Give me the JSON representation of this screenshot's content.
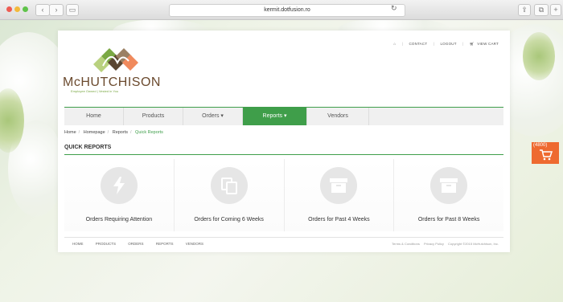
{
  "browser": {
    "url": "kermit.dotfusion.ro",
    "back_icon": "chevron-left-icon",
    "forward_icon": "chevron-right-icon"
  },
  "header": {
    "links": [
      {
        "label": "CONTACT"
      },
      {
        "label": "LOGOUT"
      },
      {
        "label": "VIEW CART"
      }
    ]
  },
  "logo": {
    "name": "McHUTCHISON",
    "tagline": "Employee Owned | Vested in You",
    "colors": {
      "green": "#7aa844",
      "brown": "#6b4a2e",
      "orange": "#f08a5d",
      "dark": "#5a4632"
    }
  },
  "nav": {
    "items": [
      {
        "label": "Home",
        "active": false
      },
      {
        "label": "Products",
        "active": false
      },
      {
        "label": "Orders ▾",
        "active": false
      },
      {
        "label": "Reports ▾",
        "active": true
      },
      {
        "label": "Vendors",
        "active": false
      }
    ]
  },
  "breadcrumb": {
    "items": [
      "Home",
      "Homepage",
      "Reports",
      "Quick Reports"
    ]
  },
  "main": {
    "section_title": "QUICK REPORTS",
    "cards": [
      {
        "label": "Orders Requiring Attention",
        "icon": "lightning-icon"
      },
      {
        "label": "Orders for Coming 6 Weeks",
        "icon": "copy-icon"
      },
      {
        "label": "Orders for Past 4 Weeks",
        "icon": "archive-icon"
      },
      {
        "label": "Orders for Past 8 Weeks",
        "icon": "archive-icon"
      }
    ]
  },
  "footer": {
    "links": [
      "HOME",
      "PRODUCTS",
      "ORDERS",
      "REPORTS",
      "VENDORS"
    ],
    "right": [
      "Terms & Conditions",
      "Privacy Policy",
      "Copyright ©2015 McHutchison, Inc."
    ]
  },
  "cart_tab": {
    "count": "(4800)",
    "color": "#ee6a30"
  },
  "colors": {
    "accent": "#3f9e4a"
  }
}
